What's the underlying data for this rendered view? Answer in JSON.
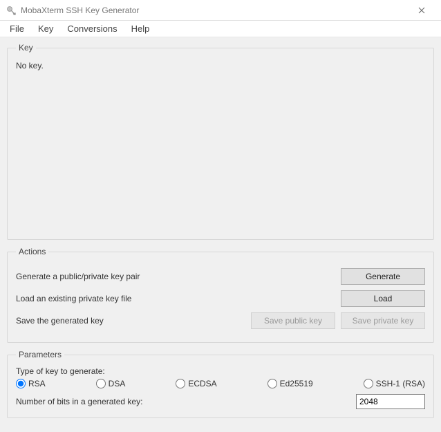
{
  "window": {
    "title": "MobaXterm SSH Key Generator"
  },
  "menu": {
    "file": "File",
    "key": "Key",
    "conversions": "Conversions",
    "help": "Help"
  },
  "key_group": {
    "legend": "Key",
    "status": "No key."
  },
  "actions": {
    "legend": "Actions",
    "generate_label": "Generate a public/private key pair",
    "generate_button": "Generate",
    "load_label": "Load an existing private key file",
    "load_button": "Load",
    "save_label": "Save the generated key",
    "save_public_button": "Save public key",
    "save_private_button": "Save private key"
  },
  "parameters": {
    "legend": "Parameters",
    "type_label": "Type of key to generate:",
    "options": {
      "rsa": "RSA",
      "dsa": "DSA",
      "ecdsa": "ECDSA",
      "ed25519": "Ed25519",
      "ssh1": "SSH-1 (RSA)"
    },
    "selected": "rsa",
    "bits_label": "Number of bits in a generated key:",
    "bits_value": "2048"
  }
}
